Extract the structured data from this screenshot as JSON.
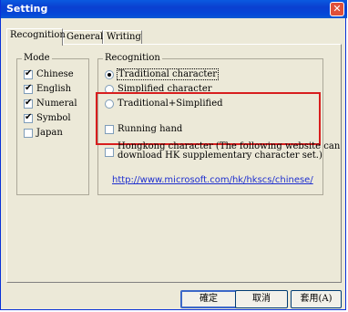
{
  "window": {
    "title": "Setting",
    "close_label": "✕"
  },
  "tabs": [
    {
      "label": "Recognition"
    },
    {
      "label": "General"
    },
    {
      "label": "Writing"
    }
  ],
  "mode": {
    "title": "Mode",
    "items": [
      {
        "label": "Chinese",
        "checked": true
      },
      {
        "label": "English",
        "checked": true
      },
      {
        "label": "Numeral",
        "checked": true
      },
      {
        "label": "Symbol",
        "checked": true
      },
      {
        "label": "Japan",
        "checked": false
      }
    ]
  },
  "recognition": {
    "title": "Recognition",
    "options": [
      {
        "label": "Traditional character",
        "selected": true
      },
      {
        "label": "Simplified character",
        "selected": false
      },
      {
        "label": "Traditional+Simplified",
        "selected": false
      }
    ],
    "running_hand": "Running hand",
    "hongkong_line1": "Hongkong character (The following website can",
    "hongkong_line2": "download HK supplementary character set.)",
    "link": "http://www.microsoft.com/hk/hkscs/chinese/"
  },
  "buttons": {
    "ok": "確定",
    "cancel": "取消",
    "apply": "套用(A)"
  },
  "colors": {
    "highlight_border": "#d81e1e",
    "link": "#1e2fcf",
    "titlebar": "#0a4fd8"
  }
}
